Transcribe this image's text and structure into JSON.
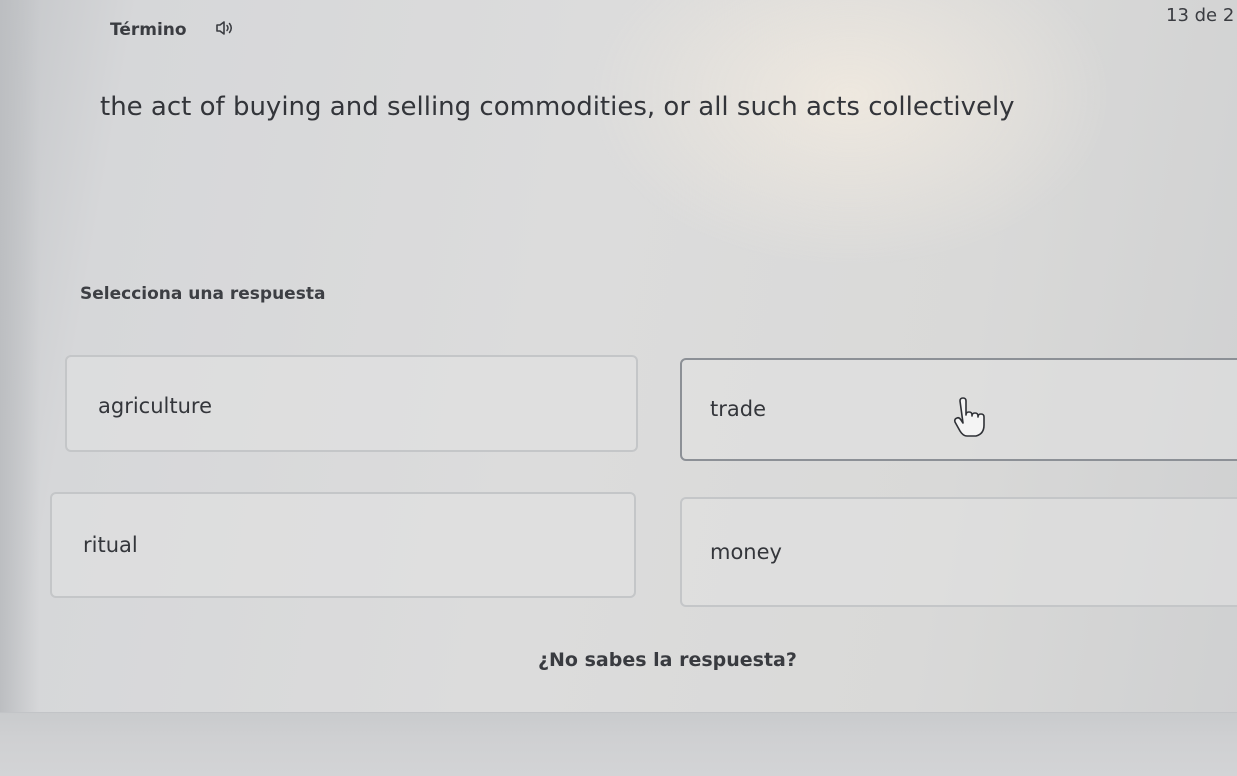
{
  "header": {
    "term_label": "Término",
    "counter": "13 de 2"
  },
  "question": {
    "definition": "the act of buying and selling commodities, or all such acts collectively",
    "prompt": "Selecciona una respuesta"
  },
  "options": [
    {
      "label": "agriculture"
    },
    {
      "label": "trade"
    },
    {
      "label": "ritual"
    },
    {
      "label": "money"
    }
  ],
  "footer": {
    "dont_know": "¿No sabes la respuesta?"
  },
  "icons": {
    "audio": "speaker-icon",
    "pointer": "hand-cursor-icon"
  }
}
